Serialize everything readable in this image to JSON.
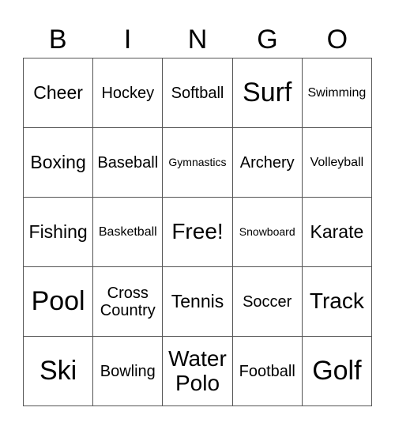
{
  "header": [
    "B",
    "I",
    "N",
    "G",
    "O"
  ],
  "cells": [
    {
      "text": "Cheer",
      "size": "s-m"
    },
    {
      "text": "Hockey",
      "size": "s-n"
    },
    {
      "text": "Softball",
      "size": "s-n"
    },
    {
      "text": "Surf",
      "size": "s-xl"
    },
    {
      "text": "Swimming",
      "size": "s-s"
    },
    {
      "text": "Boxing",
      "size": "s-m"
    },
    {
      "text": "Baseball",
      "size": "s-n"
    },
    {
      "text": "Gymnastics",
      "size": "s-xs"
    },
    {
      "text": "Archery",
      "size": "s-n"
    },
    {
      "text": "Volleyball",
      "size": "s-s"
    },
    {
      "text": "Fishing",
      "size": "s-m"
    },
    {
      "text": "Basketball",
      "size": "s-s"
    },
    {
      "text": "Free!",
      "size": "s-l"
    },
    {
      "text": "Snowboard",
      "size": "s-xs"
    },
    {
      "text": "Karate",
      "size": "s-m"
    },
    {
      "text": "Pool",
      "size": "s-xl"
    },
    {
      "text": "Cross Country",
      "size": "s-n"
    },
    {
      "text": "Tennis",
      "size": "s-m"
    },
    {
      "text": "Soccer",
      "size": "s-n"
    },
    {
      "text": "Track",
      "size": "s-l"
    },
    {
      "text": "Ski",
      "size": "s-xl"
    },
    {
      "text": "Bowling",
      "size": "s-n"
    },
    {
      "text": "Water Polo",
      "size": "s-l"
    },
    {
      "text": "Football",
      "size": "s-n"
    },
    {
      "text": "Golf",
      "size": "s-xl"
    }
  ]
}
